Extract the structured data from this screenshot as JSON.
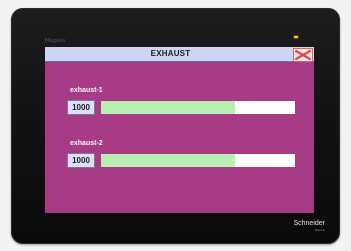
{
  "device": {
    "model": "Magelis",
    "brand": "Schneider",
    "brand_subtitle": "Electric"
  },
  "screen": {
    "title": "EXHAUST",
    "close_icon": "close-icon"
  },
  "rows": [
    {
      "label": "exhaust-1",
      "value": "1000",
      "bar_level_percent": 69
    },
    {
      "label": "exhaust-2",
      "value": "1000",
      "bar_level_percent": 69
    }
  ],
  "colors": {
    "screen_background": "#a73b86",
    "title_bar": "#cdd5f3",
    "bar_track": "#ffffff",
    "bar_fill": "#b9efb0",
    "value_box": "#dbe0f7",
    "led": "#f2c824"
  }
}
